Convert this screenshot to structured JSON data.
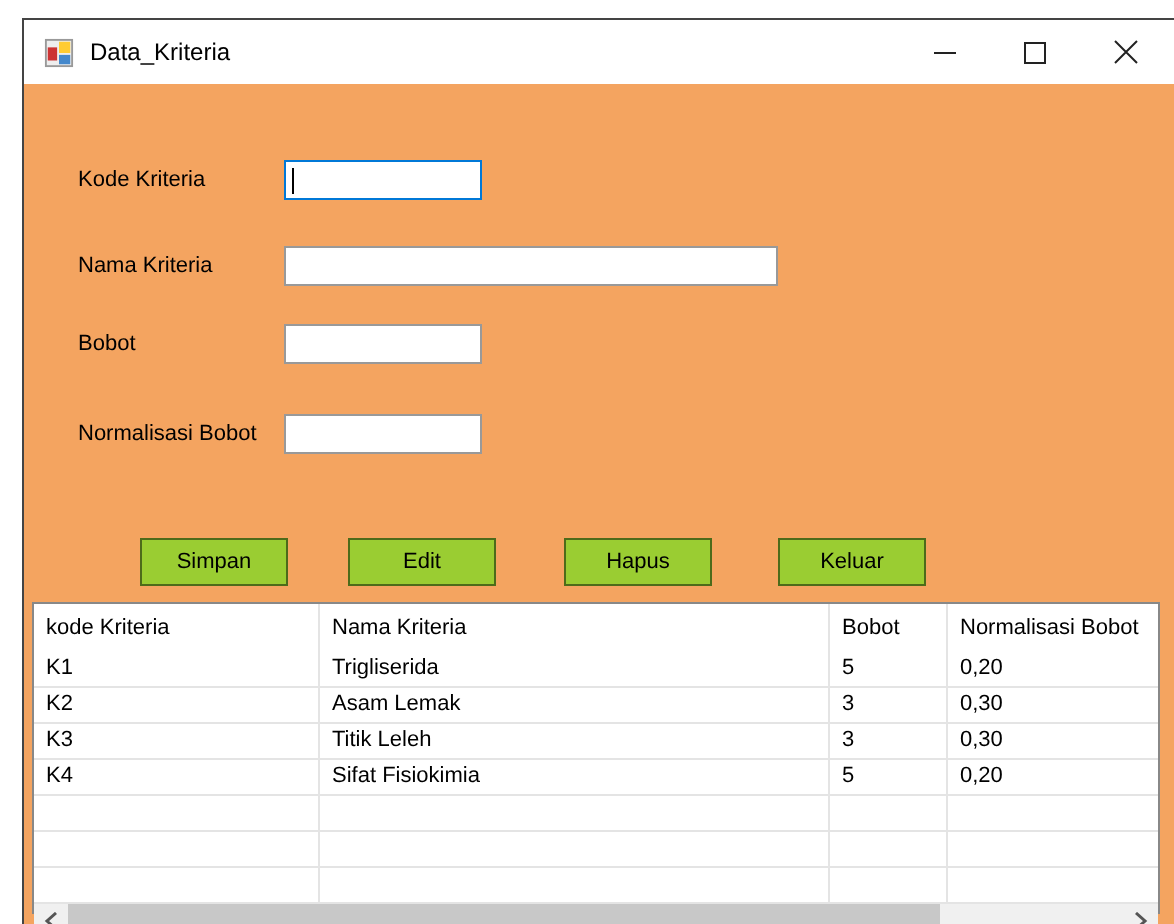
{
  "window": {
    "title": "Data_Kriteria"
  },
  "fields": [
    {
      "label": "Kode Kriteria",
      "focused": true,
      "wide": false
    },
    {
      "label": "Nama Kriteria",
      "focused": false,
      "wide": true
    },
    {
      "label": "Bobot",
      "focused": false,
      "wide": false
    },
    {
      "label": "Normalisasi Bobot",
      "focused": false,
      "wide": false
    }
  ],
  "buttons": [
    "Simpan",
    "Edit",
    "Hapus",
    "Keluar"
  ],
  "table": {
    "columns": [
      "kode Kriteria",
      "Nama Kriteria",
      "Bobot",
      "Normalisasi Bobot"
    ],
    "rows": [
      [
        "K1",
        "Trigliserida",
        "5",
        "0,20"
      ],
      [
        "K2",
        "Asam Lemak",
        "3",
        "0,30"
      ],
      [
        "K3",
        "Titik Leleh",
        "3",
        "0,30"
      ],
      [
        "K4",
        "Sifat Fisiokimia",
        "5",
        "0,20"
      ]
    ]
  }
}
